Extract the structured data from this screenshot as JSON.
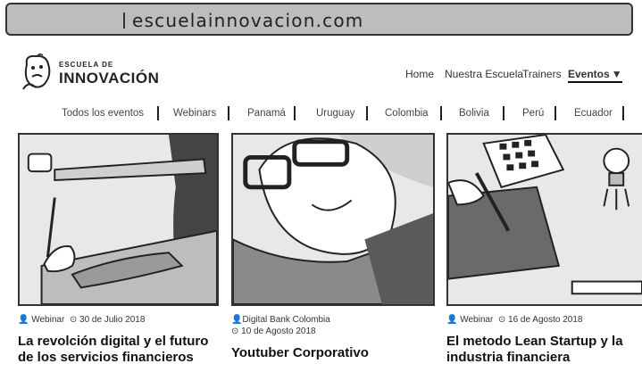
{
  "browser": {
    "url": "escuelainnovacion.com"
  },
  "logo": {
    "line1": "ESCUELA DE",
    "line2": "INNOVACIÓN"
  },
  "nav": {
    "items": [
      {
        "label": "Home"
      },
      {
        "label": "Nuestra Escuela"
      },
      {
        "label": "Trainers"
      },
      {
        "label": "Eventos",
        "active": true
      }
    ]
  },
  "filters": [
    "Todos los eventos",
    "Webinars",
    "Panamá",
    "Uruguay",
    "Colombia",
    "Bolivia",
    "Perú",
    "Ecuador"
  ],
  "cards": [
    {
      "type": "Webinar",
      "date": "30 de Julio 2018",
      "title": "La revolción digital y el futuro de los servicios financieros"
    },
    {
      "type": "Digital Bank Colombia",
      "date": "10 de Agosto 2018",
      "title": "Youtuber Corporativo"
    },
    {
      "type": "Webinar",
      "date": "16 de Agosto 2018",
      "title": "El metodo Lean Startup y la industria financiera"
    }
  ],
  "colors": {
    "thumb_bg": "#e6e6e6",
    "url_bar": "#bdbdbd",
    "ink": "#222222"
  }
}
